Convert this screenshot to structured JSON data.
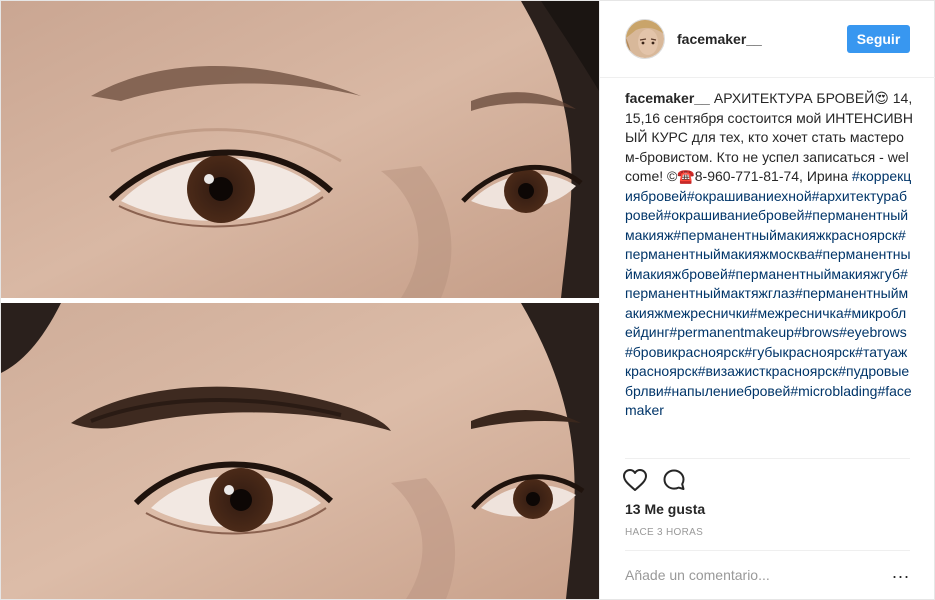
{
  "header": {
    "username": "facemaker__",
    "follow_label": "Seguir"
  },
  "post": {
    "images": [
      {
        "name": "before-eye-photo",
        "icon": "eye-closeup-photo"
      },
      {
        "name": "after-eye-photo",
        "icon": "eye-closeup-photo"
      }
    ]
  },
  "caption": {
    "author": "facemaker__",
    "text": "АРХИТЕКТУРА БРОВЕЙ😍 14,15,16 сентября состоится мой ИНТЕНСИВНЫЙ КУРС для тех, кто хочет стать мастером-бровистом. Кто не успел записаться - welcome! ©☎️8-960-771-81-74, Ирина",
    "hashtags": "#коррекциябровей#окрашиваниехной#архитектурабровей#окрашиваниебровей#перманентныймакияж#перманентныймакияжкрасноярск#перманентныймакияжмосква#перманентныймакияжбровей#перманентныймакияжгуб#перманентныймактяжглаз#перманентныймакияжмежреснички#межресничка#микроблейдинг#permanentmakeup#brows#eyebrows#бровикрасноярск#губыкрасноярск#татуажкрасноярск#визажисткрасноярск#пудровыебрлви#напылениебровей#microblading#facemaker"
  },
  "actions": {
    "like_icon": "heart-icon",
    "comment_icon": "comment-icon"
  },
  "likes": "13 Me gusta",
  "timestamp": "HACE 3 HORAS",
  "comment": {
    "placeholder": "Añade un comentario...",
    "value": "",
    "more_label": "..."
  },
  "colors": {
    "accent": "#3897f0",
    "hashtag": "#003569",
    "text": "#262626",
    "muted": "#999999",
    "border": "#efefef"
  }
}
